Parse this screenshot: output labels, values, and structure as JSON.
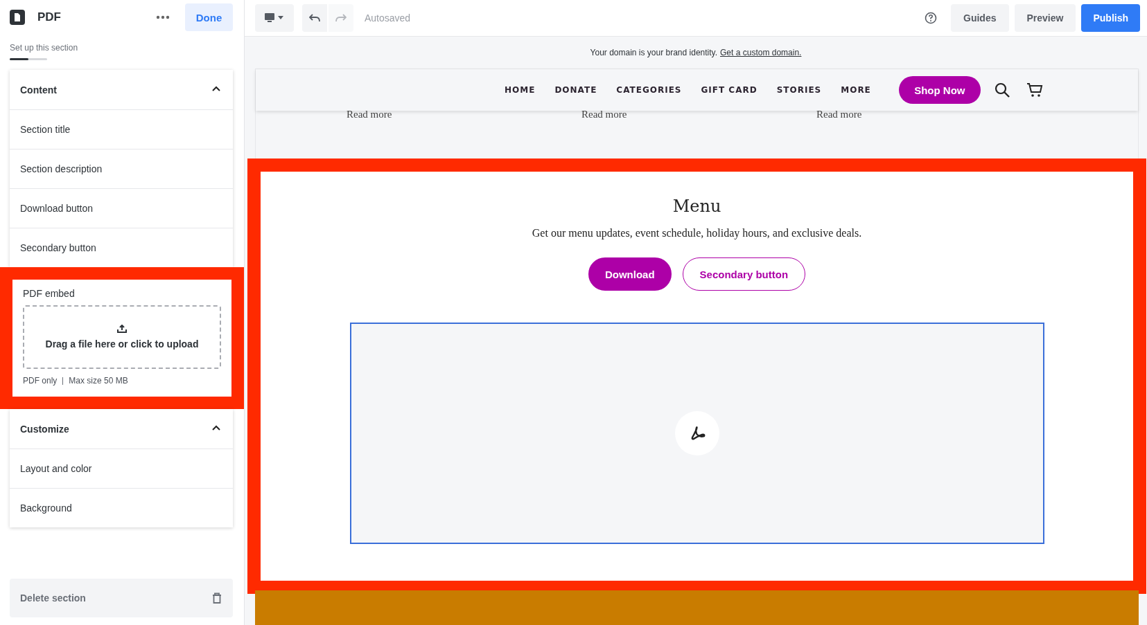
{
  "sidebar": {
    "title": "PDF",
    "done_button": "Done",
    "subtitle": "Set up this section",
    "progress": {
      "level": 0.5
    },
    "sections": [
      {
        "title": "Content",
        "expanded": true,
        "items": [
          {
            "kind": "row",
            "label": "Section title"
          },
          {
            "kind": "row",
            "label": "Section description"
          },
          {
            "kind": "row",
            "label": "Download button"
          },
          {
            "kind": "row",
            "label": "Secondary button"
          },
          {
            "kind": "upload",
            "label": "PDF embed",
            "highlighted": true,
            "dropzone": "Drag a file here or click to upload",
            "hints": [
              "PDF only",
              "Max size 50 MB"
            ]
          }
        ]
      },
      {
        "title": "Customize",
        "expanded": true,
        "items": [
          {
            "kind": "row",
            "label": "Layout and color"
          },
          {
            "kind": "row",
            "label": "Background"
          }
        ]
      }
    ],
    "delete_button": "Delete section"
  },
  "toolbar": {
    "status": "Autosaved",
    "buttons": [
      "Guides",
      "Preview"
    ],
    "publish": "Publish"
  },
  "banner": {
    "text": "Your domain is your brand identity.",
    "link": "Get a custom domain."
  },
  "site_nav": {
    "items": [
      "HOME",
      "DONATE",
      "CATEGORIES",
      "GIFT CARD",
      "STORIES",
      "MORE"
    ],
    "cta": "Shop Now"
  },
  "previous_section": {
    "links": [
      "Read more",
      "Read more",
      "Read more"
    ]
  },
  "pdf_section": {
    "highlighted": true,
    "title": "Menu",
    "description": "Get our menu updates, event schedule, holiday hours, and exclusive deals.",
    "primary_button": "Download",
    "secondary_button": "Secondary button"
  }
}
